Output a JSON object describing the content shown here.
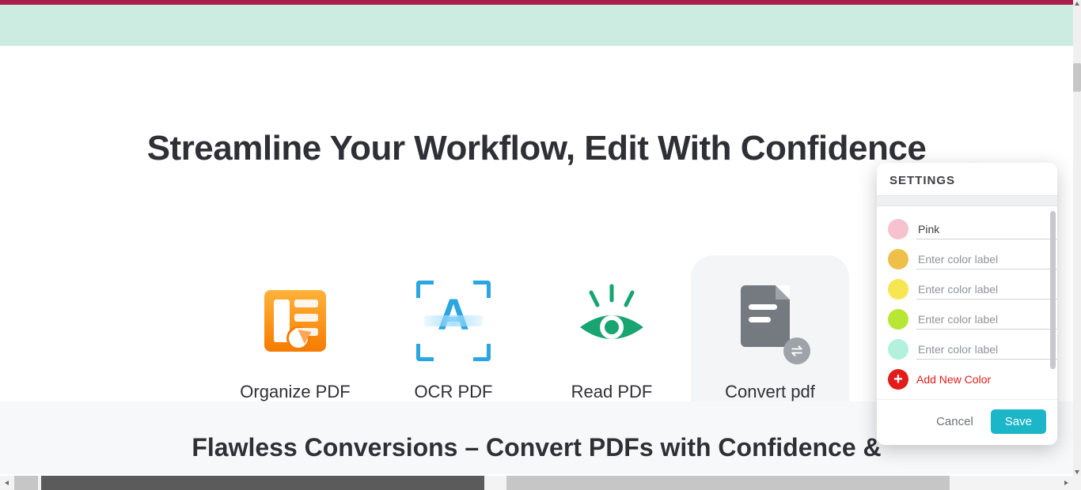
{
  "heading": "Streamline Your Workflow, Edit With Confidence",
  "cards": {
    "organize": "Organize PDF",
    "ocr": "OCR PDF",
    "read": "Read PDF",
    "convert": "Convert pdf"
  },
  "section2_title": "Flawless Conversions – Convert PDFs with Confidence &",
  "popover": {
    "title": "SETTINGS",
    "rows": {
      "pink_value": "Pink",
      "placeholder": "Enter color label"
    },
    "add_label": "Add New Color",
    "cancel": "Cancel",
    "save": "Save"
  }
}
